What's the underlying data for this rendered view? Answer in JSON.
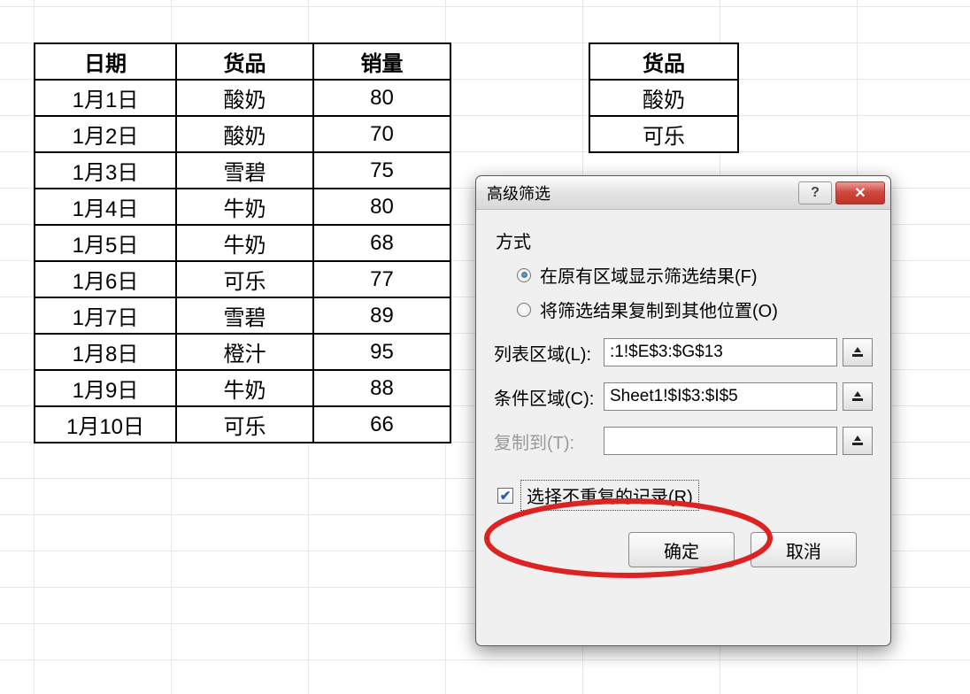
{
  "main_table": {
    "headers": [
      "日期",
      "货品",
      "销量"
    ],
    "rows": [
      [
        "1月1日",
        "酸奶",
        "80"
      ],
      [
        "1月2日",
        "酸奶",
        "70"
      ],
      [
        "1月3日",
        "雪碧",
        "75"
      ],
      [
        "1月4日",
        "牛奶",
        "80"
      ],
      [
        "1月5日",
        "牛奶",
        "68"
      ],
      [
        "1月6日",
        "可乐",
        "77"
      ],
      [
        "1月7日",
        "雪碧",
        "89"
      ],
      [
        "1月8日",
        "橙汁",
        "95"
      ],
      [
        "1月9日",
        "牛奶",
        "88"
      ],
      [
        "1月10日",
        "可乐",
        "66"
      ]
    ]
  },
  "side_table": {
    "header": "货品",
    "rows": [
      "酸奶",
      "可乐"
    ]
  },
  "dialog": {
    "title": "高级筛选",
    "method_label": "方式",
    "radio1": "在原有区域显示筛选结果(F)",
    "radio2": "将筛选结果复制到其他位置(O)",
    "list_label": "列表区域(L):",
    "list_value": ":1!$E$3:$G$13",
    "cond_label": "条件区域(C):",
    "cond_value": "Sheet1!$I$3:$I$5",
    "copy_label": "复制到(T):",
    "copy_value": "",
    "unique_label": "选择不重复的记录(R)",
    "ok": "确定",
    "cancel": "取消"
  }
}
